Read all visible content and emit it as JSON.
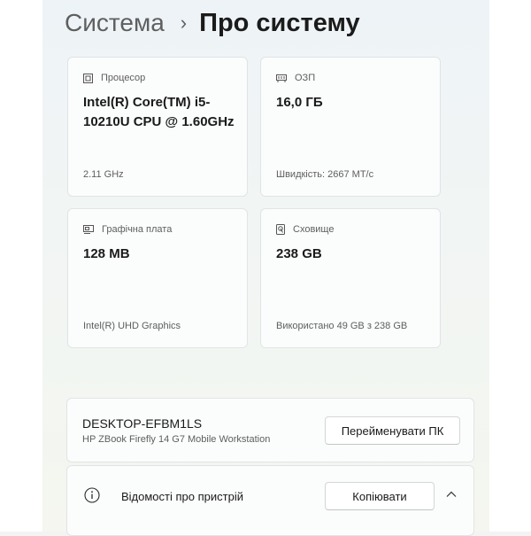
{
  "breadcrumb": {
    "parent": "Система",
    "separator": "›",
    "current": "Про систему"
  },
  "specs": {
    "cpu": {
      "label": "Процесор",
      "value": "Intel(R) Core(TM) i5-10210U CPU @ 1.60GHz",
      "footer": "2.11 GHz",
      "icon": "processor-icon"
    },
    "ram": {
      "label": "ОЗП",
      "value": "16,0 ГБ",
      "footer": "Швидкість: 2667 МТ/с",
      "icon": "memory-icon"
    },
    "gpu": {
      "label": "Графічна плата",
      "value": "128 MB",
      "footer": "Intel(R) UHD Graphics",
      "icon": "graphics-card-icon"
    },
    "storage": {
      "label": "Сховище",
      "value": "238 GB",
      "footer": "Використано 49 GB з 238 GB",
      "icon": "storage-icon"
    }
  },
  "device": {
    "name": "DESKTOP-EFBM1LS",
    "model": "HP ZBook Firefly 14 G7 Mobile Workstation",
    "rename_button": "Перейменувати ПК"
  },
  "device_specs": {
    "title": "Відомості про пристрій",
    "copy_button": "Копіювати",
    "icon": "info-icon",
    "expander_icon": "chevron-up-icon"
  }
}
